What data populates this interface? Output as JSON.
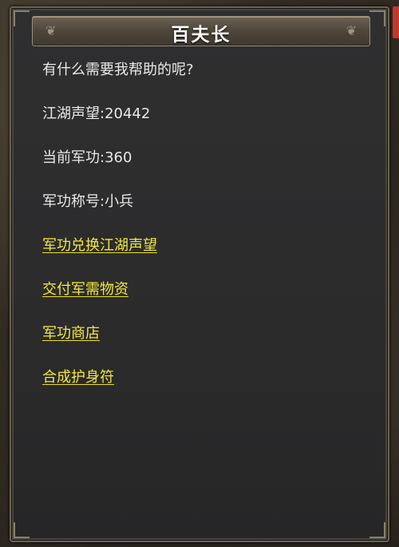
{
  "dialog": {
    "title": "百夫长",
    "ornament_left": "❦",
    "ornament_right": "❦"
  },
  "info": {
    "greeting": "有什么需要我帮助的呢?",
    "reputation": "江湖声望:20442",
    "merit": "当前军功:360",
    "merit_title": "军功称号:小兵"
  },
  "options": {
    "exchange_reputation": "军功兑换江湖声望",
    "deliver_supplies": "交付军需物资",
    "merit_shop": "军功商店",
    "craft_amulet": "合成护身符"
  },
  "colors": {
    "link": "#f2e83a",
    "text": "#e8e8e8",
    "title": "#ffffff"
  }
}
